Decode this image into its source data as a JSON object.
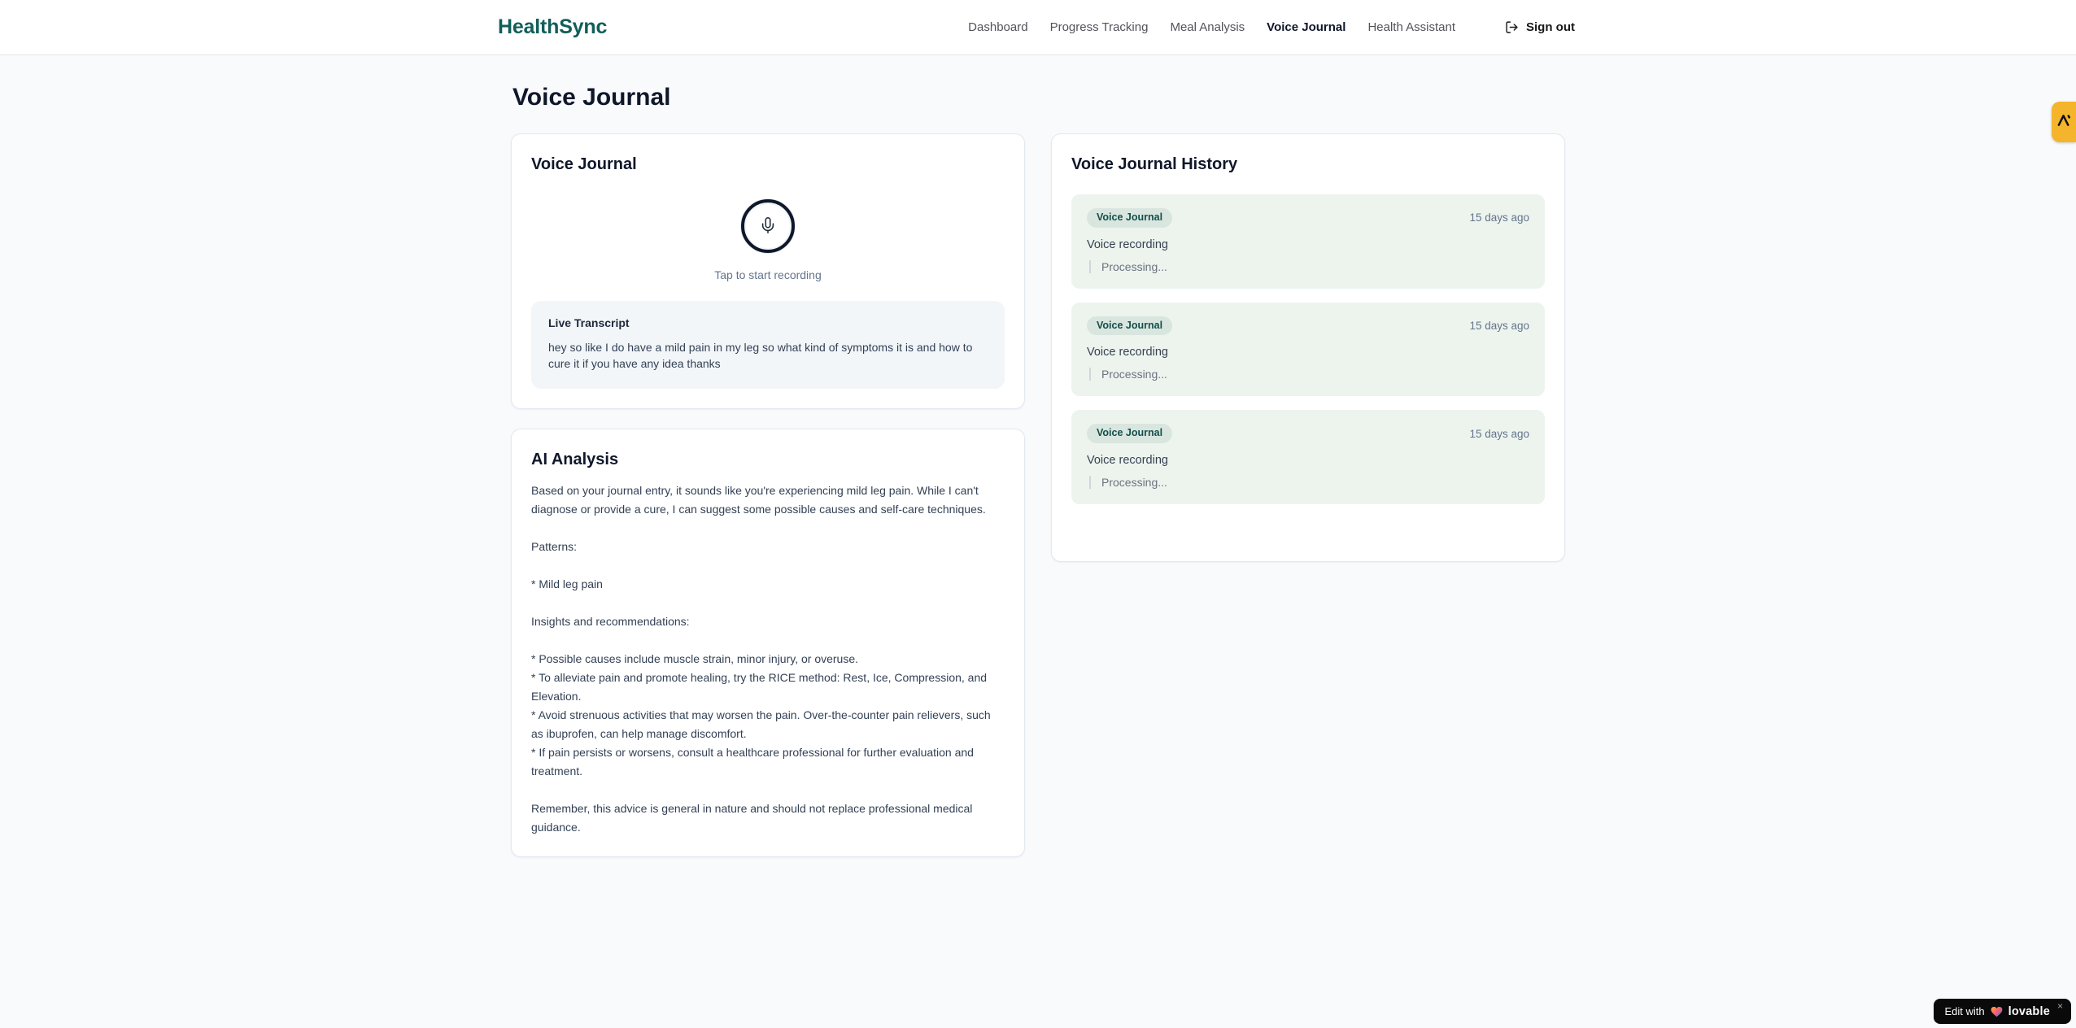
{
  "header": {
    "brand": "HealthSync",
    "nav": [
      {
        "label": "Dashboard",
        "active": false
      },
      {
        "label": "Progress Tracking",
        "active": false
      },
      {
        "label": "Meal Analysis",
        "active": false
      },
      {
        "label": "Voice Journal",
        "active": true
      },
      {
        "label": "Health Assistant",
        "active": false
      }
    ],
    "signout_label": "Sign out"
  },
  "page": {
    "title": "Voice Journal"
  },
  "recorder_card": {
    "title": "Voice Journal",
    "tap_hint": "Tap to start recording",
    "transcript_title": "Live Transcript",
    "transcript_text": "hey so like I do have a mild pain in my leg so what kind of symptoms it is and how to cure it if you have any idea thanks"
  },
  "analysis_card": {
    "title": "AI Analysis",
    "body": "Based on your journal entry, it sounds like you're experiencing mild leg pain. While I can't diagnose or provide a cure, I can suggest some possible causes and self-care techniques.\n\nPatterns:\n\n* Mild leg pain\n\nInsights and recommendations:\n\n* Possible causes include muscle strain, minor injury, or overuse.\n* To alleviate pain and promote healing, try the RICE method: Rest, Ice, Compression, and Elevation.\n* Avoid strenuous activities that may worsen the pain. Over-the-counter pain relievers, such as ibuprofen, can help manage discomfort.\n* If pain persists or worsens, consult a healthcare professional for further evaluation and treatment.\n\nRemember, this advice is general in nature and should not replace professional medical guidance."
  },
  "history_card": {
    "title": "Voice Journal History",
    "entries": [
      {
        "badge": "Voice Journal",
        "time": "15 days ago",
        "label": "Voice recording",
        "status": "Processing..."
      },
      {
        "badge": "Voice Journal",
        "time": "15 days ago",
        "label": "Voice recording",
        "status": "Processing..."
      },
      {
        "badge": "Voice Journal",
        "time": "15 days ago",
        "label": "Voice recording",
        "status": "Processing..."
      }
    ]
  },
  "widgets": {
    "lovable": {
      "prefix": "Edit with",
      "brand": "lovable",
      "close": "×"
    }
  },
  "colors": {
    "brand_teal": "#115e59",
    "page_background": "#f8fafc",
    "entry_background": "#edf4ee",
    "badge_background": "#d9e6df",
    "badge_text": "#134e4a",
    "feedback_tab": "#f4b42c",
    "lovable_badge": "#0a0a0a"
  }
}
